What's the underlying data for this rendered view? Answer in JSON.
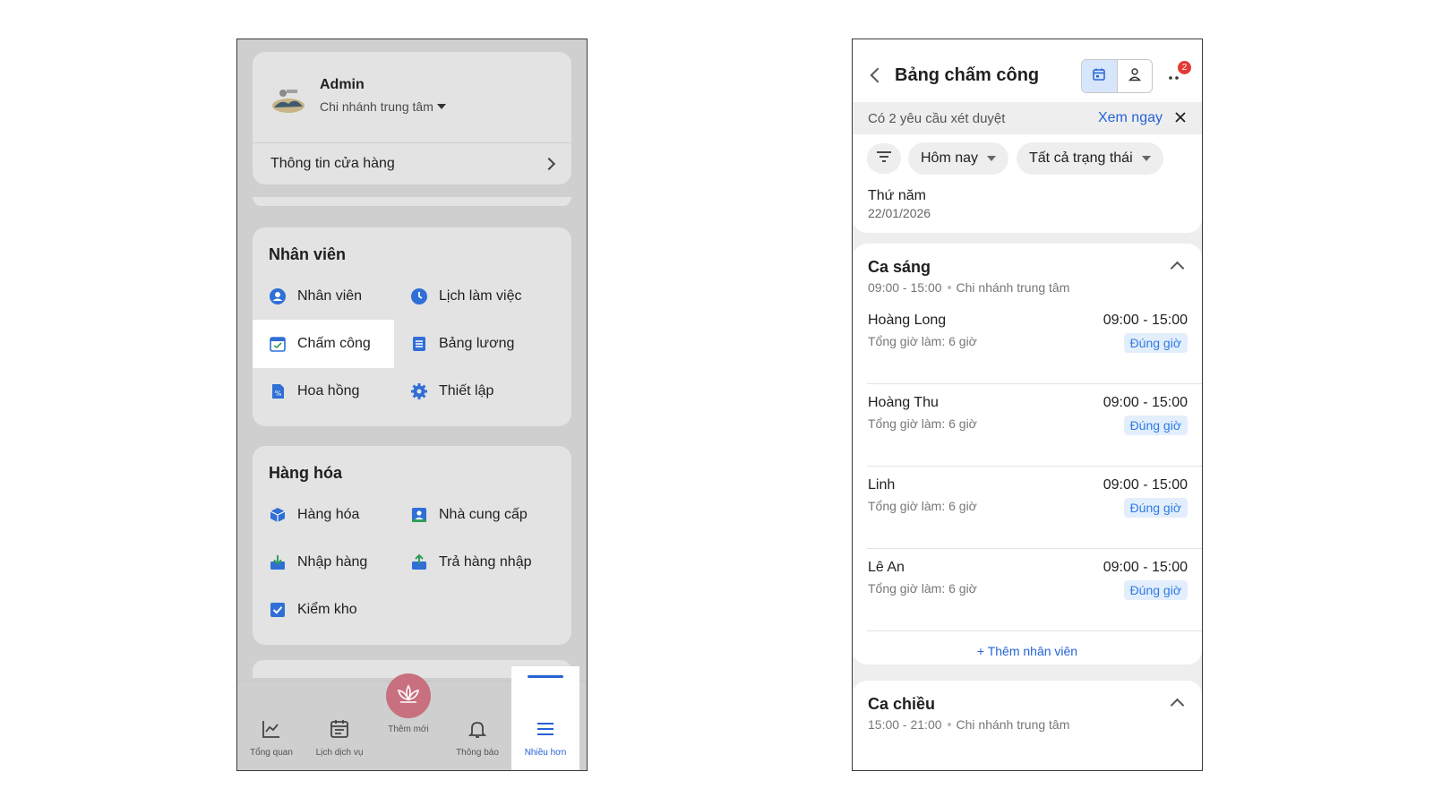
{
  "left_screen": {
    "profile": {
      "name": "Admin",
      "branch": "Chi nhánh trung tâm",
      "store_info": "Thông tin cửa hàng"
    },
    "staff_section": {
      "title": "Nhân viên",
      "items": [
        {
          "label": "Nhân viên",
          "icon": "user-circle-icon"
        },
        {
          "label": "Lịch làm việc",
          "icon": "clock-icon"
        },
        {
          "label": "Chấm công",
          "icon": "calendar-check-icon"
        },
        {
          "label": "Bảng lương",
          "icon": "list-doc-icon"
        },
        {
          "label": "Hoa hồng",
          "icon": "percent-doc-icon"
        },
        {
          "label": "Thiết lập",
          "icon": "gear-icon"
        }
      ]
    },
    "goods_section": {
      "title": "Hàng hóa",
      "items": [
        {
          "label": "Hàng hóa",
          "icon": "box-icon"
        },
        {
          "label": "Nhà cung cấp",
          "icon": "supplier-icon"
        },
        {
          "label": "Nhập hàng",
          "icon": "import-icon"
        },
        {
          "label": "Trả hàng nhập",
          "icon": "return-icon"
        },
        {
          "label": "Kiểm kho",
          "icon": "checkbox-icon"
        }
      ]
    },
    "bottom_nav": {
      "overview": "Tổng quan",
      "schedule": "Lịch dịch vụ",
      "add_new": "Thêm mới",
      "notifications": "Thông báo",
      "more": "Nhiều hơn"
    },
    "colors": {
      "accent": "#2563d6",
      "center_button": "#c8707f"
    }
  },
  "right_screen": {
    "title": "Bảng chấm công",
    "notification_count": "2",
    "request_bar": {
      "text": "Có 2 yêu cầu xét duyệt",
      "link": "Xem ngay"
    },
    "filters": {
      "date": "Hôm nay",
      "status": "Tất cả trạng thái"
    },
    "day": {
      "weekday": "Thứ năm",
      "date": "22/01/2026"
    },
    "shifts": [
      {
        "name": "Ca sáng",
        "time": "09:00 - 15:00",
        "branch": "Chi nhánh trung tâm",
        "employees": [
          {
            "name": "Hoàng Long",
            "hours": "Tổng giờ làm: 6 giờ",
            "time": "09:00 - 15:00",
            "status": "Đúng giờ"
          },
          {
            "name": "Hoàng Thu",
            "hours": "Tổng giờ làm: 6 giờ",
            "time": "09:00 - 15:00",
            "status": "Đúng giờ"
          },
          {
            "name": "Linh",
            "hours": "Tổng giờ làm: 6 giờ",
            "time": "09:00 - 15:00",
            "status": "Đúng giờ"
          },
          {
            "name": "Lê An",
            "hours": "Tổng giờ làm: 6 giờ",
            "time": "09:00 - 15:00",
            "status": "Đúng giờ"
          }
        ],
        "add_label": "+ Thêm nhân viên"
      },
      {
        "name": "Ca chiều",
        "time": "15:00 - 21:00",
        "branch": "Chi nhánh trung tâm"
      }
    ],
    "colors": {
      "link": "#2563d6",
      "status_bg": "#e3eefc",
      "status_text": "#2e7be6",
      "badge": "#e53935"
    }
  }
}
